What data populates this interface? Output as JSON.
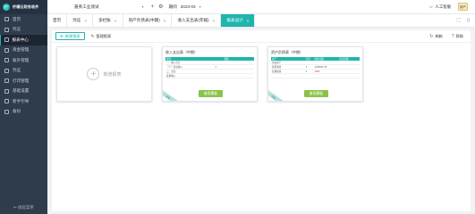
{
  "app": {
    "logo_text": "柠檬云财务软件"
  },
  "sidebar": {
    "items": [
      {
        "label": "首页",
        "icon": "home-icon",
        "active": false
      },
      {
        "label": "凭证",
        "icon": "voucher-icon",
        "active": false
      },
      {
        "label": "报表中心",
        "icon": "report-icon",
        "active": true
      },
      {
        "label": "资金管理",
        "icon": "fund-icon",
        "active": false
      },
      {
        "label": "账外管理",
        "icon": "offbook-icon",
        "active": false
      },
      {
        "label": "凭证",
        "icon": "voucher-icon",
        "active": false
      },
      {
        "label": "打印管理",
        "icon": "print-icon",
        "active": false
      },
      {
        "label": "基础设置",
        "icon": "settings-icon",
        "active": false
      },
      {
        "label": "新手引导",
        "icon": "guide-icon",
        "active": false
      },
      {
        "label": "备份",
        "icon": "backup-icon",
        "active": false
      }
    ],
    "collapse_label": "收起菜单"
  },
  "header": {
    "company": "嘉英工业测试",
    "period_label": "期间",
    "period_value": "2023-03",
    "ai_label": "人工客服",
    "avatar_text": "用户"
  },
  "tabs": [
    {
      "label": "首页",
      "closable": false,
      "active": false
    },
    {
      "label": "凭证",
      "closable": true,
      "active": false
    },
    {
      "label": "多栏账",
      "closable": true,
      "active": false
    },
    {
      "label": "资产负债表(中期)",
      "closable": true,
      "active": false
    },
    {
      "label": "收入支出表(年报)",
      "closable": true,
      "active": false
    },
    {
      "label": "报表设计",
      "closable": true,
      "active": true
    }
  ],
  "subtabs": [
    {
      "label": "新增报表",
      "active": true
    },
    {
      "label": "管理报表",
      "active": false
    }
  ],
  "actions": {
    "refresh": "刷新",
    "help": "帮助"
  },
  "cards": {
    "new_label": "新增报表",
    "templates": [
      {
        "title": "收入支出表（中期）",
        "headers": [
          "项目",
          "",
          "金额"
        ],
        "rows": [
          [
            "一、收入合计",
            "",
            ""
          ],
          [
            "（一）营业收入",
            "1",
            ""
          ],
          [
            "二、支出",
            "",
            ""
          ],
          [
            "其他收入",
            "",
            ""
          ]
        ],
        "button": "套用模板",
        "ribbon": "中期"
      },
      {
        "title": "资产负债表（中期）",
        "headers": [
          "资产",
          "行次",
          "期末余额",
          "年初余额"
        ],
        "rows": [
          [
            "流动资产",
            "",
            "",
            ""
          ],
          [
            "货币资金",
            "1",
            "1234567.00",
            ""
          ],
          [
            "短期投资",
            "2",
            "¥888",
            ""
          ],
          [
            "",
            "",
            "",
            ""
          ]
        ],
        "button": "套用模板",
        "ribbon": "中期"
      }
    ]
  },
  "colors": {
    "accent": "#1fb5ad",
    "sidebar_bg": "#2f3c4c",
    "button_green": "#8bc34a"
  }
}
